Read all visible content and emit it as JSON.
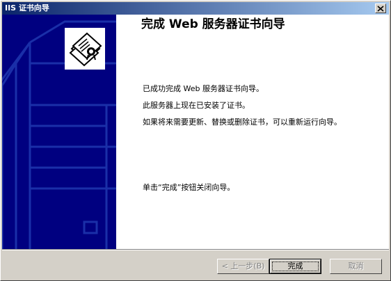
{
  "window": {
    "title": "IIS 证书向导",
    "close_symbol": "✕"
  },
  "icons": {
    "close": "close-icon",
    "certificate": "certificate-icon"
  },
  "main": {
    "heading": "完成 Web 服务器证书向导",
    "lines": [
      "已成功完成 Web 服务器证书向导。",
      "此服务器上现在已安装了证书。",
      "如果将来需要更新、替换或删除证书，可以重新运行向导。",
      "单击“完成”按钮关闭向导。"
    ]
  },
  "buttons": {
    "back": "< 上一步(B)",
    "finish": "完成",
    "cancel": "取消"
  },
  "colors": {
    "panel_blue": "#000080",
    "panel_line": "#1a2fa8",
    "title_start": "#0a246a",
    "title_end": "#a6caf0"
  }
}
